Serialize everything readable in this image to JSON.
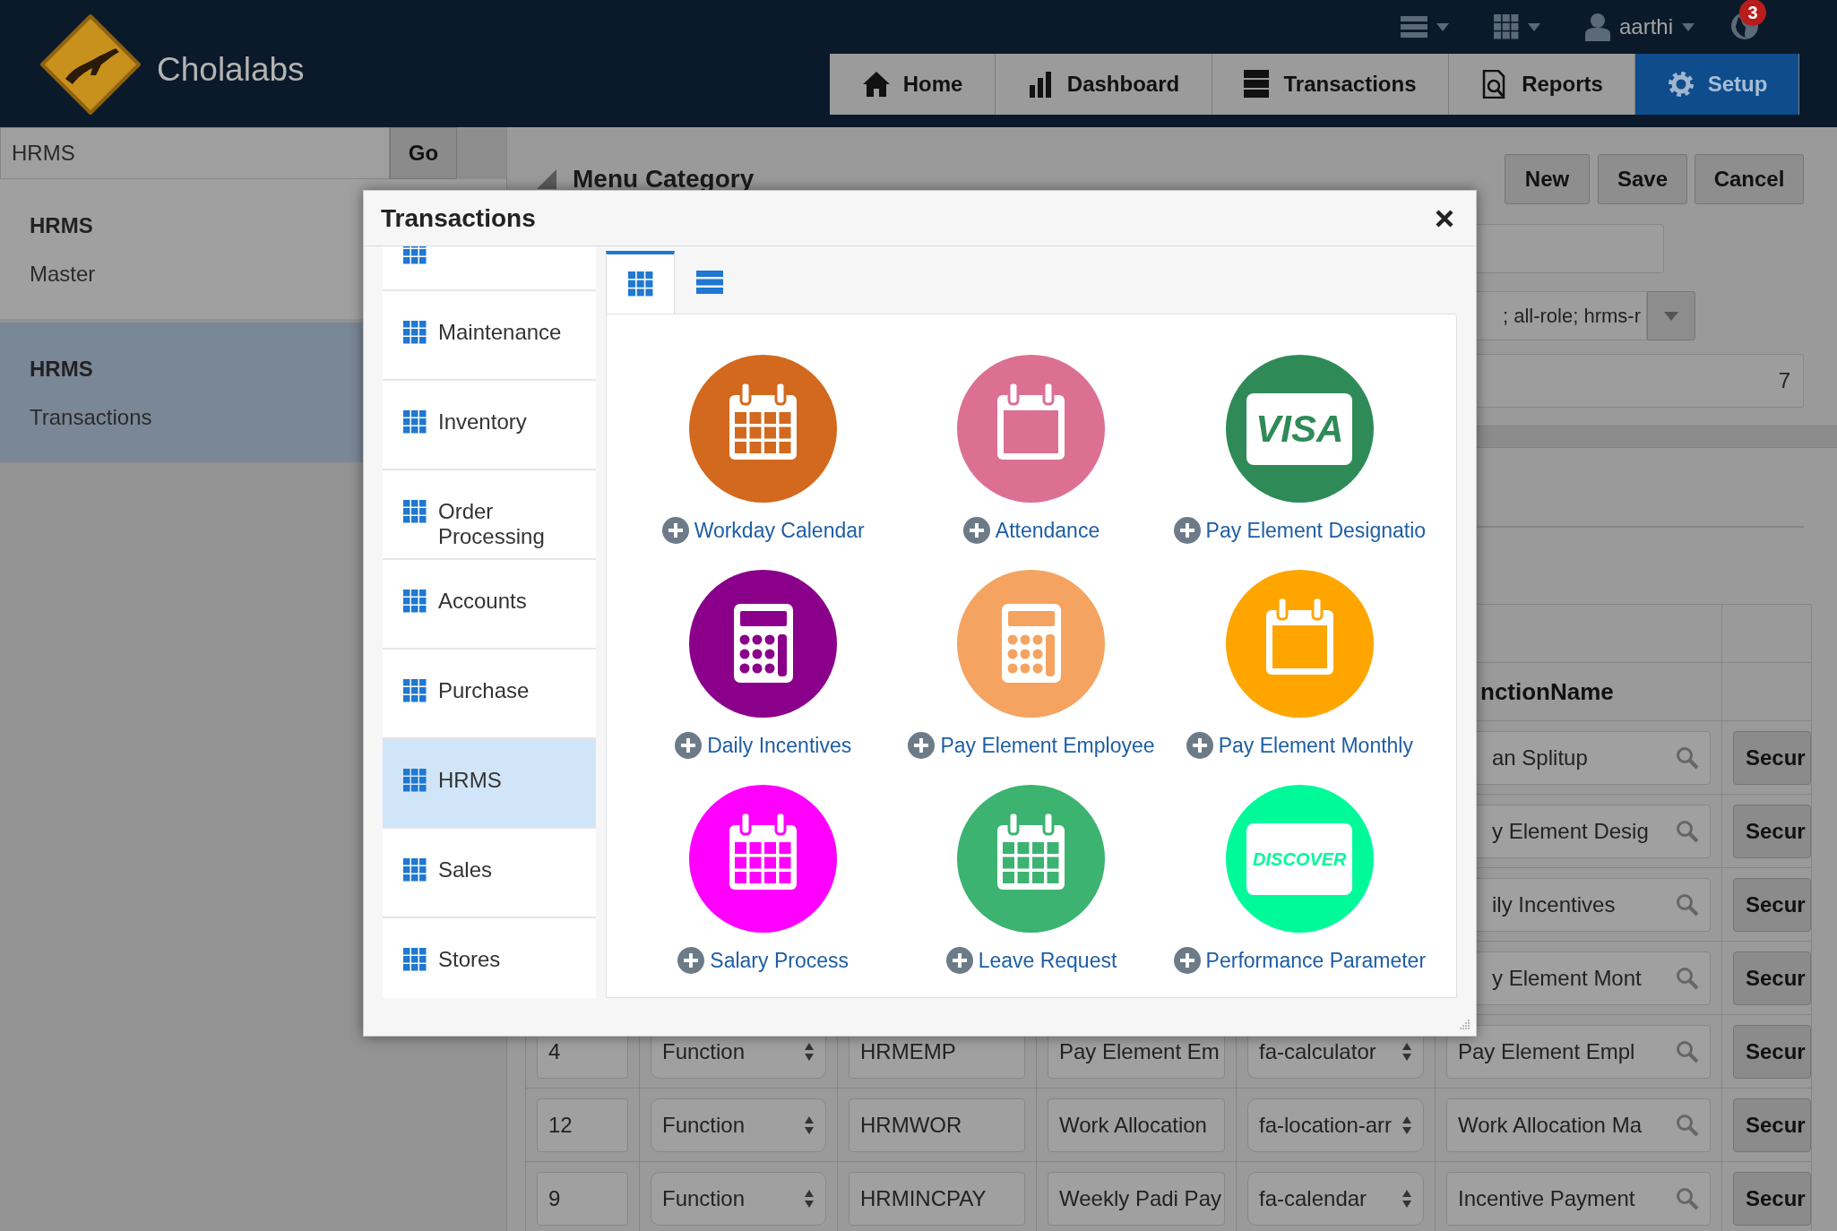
{
  "app": {
    "name": "Cholalabs"
  },
  "top_menu": {
    "user": "aarthi",
    "notification_count": "3"
  },
  "nav_tabs": [
    {
      "label": "Home",
      "selected": false
    },
    {
      "label": "Dashboard",
      "selected": false
    },
    {
      "label": "Transactions",
      "selected": false
    },
    {
      "label": "Reports",
      "selected": false
    },
    {
      "label": "Setup",
      "selected": true
    }
  ],
  "sidebar": {
    "search": {
      "value": "HRMS",
      "button": "Go"
    },
    "groups": [
      {
        "title": "HRMS",
        "item": "Master",
        "selected": false
      },
      {
        "title": "HRMS",
        "item": "Transactions",
        "selected": true
      }
    ]
  },
  "form": {
    "title": "Menu Category",
    "buttons": [
      "New",
      "Save",
      "Cancel"
    ],
    "roles_value": "; all-role; hrms-r",
    "order_value": "7"
  },
  "table": {
    "column_6": "nctionName",
    "rows": [
      {
        "function_name": "an Splitup",
        "action": "Secur"
      },
      {
        "function_name": "y Element Desig",
        "action": "Secur"
      },
      {
        "function_name": "ily Incentives",
        "action": "Secur"
      },
      {
        "function_name": "y Element Mont",
        "action": "Secur"
      },
      {
        "number": "4",
        "type": "Function",
        "code": "HRMEMP",
        "title": "Pay Element Em",
        "icon_name": "fa-calculator",
        "function_name": "Pay Element Empl",
        "action": "Secur"
      },
      {
        "number": "12",
        "type": "Function",
        "code": "HRMWOR",
        "title": "Work Allocation",
        "icon_name": "fa-location-arr",
        "function_name": "Work Allocation Ma",
        "action": "Secur"
      },
      {
        "number": "9",
        "type": "Function",
        "code": "HRMINCPAY",
        "title": "Weekly Padi Pay",
        "icon_name": "fa-calendar",
        "function_name": "Incentive Payment",
        "action": "Secur"
      }
    ]
  },
  "modal": {
    "title": "Transactions",
    "categories": [
      {
        "label": "Maintenance",
        "selected": false
      },
      {
        "label": "Inventory",
        "selected": false
      },
      {
        "label": "Order Processing",
        "selected": false
      },
      {
        "label": "Accounts",
        "selected": false
      },
      {
        "label": "Purchase",
        "selected": false
      },
      {
        "label": "HRMS",
        "selected": true
      },
      {
        "label": "Sales",
        "selected": false
      },
      {
        "label": "Stores",
        "selected": false
      }
    ],
    "view_tabs": [
      {
        "kind": "grid",
        "selected": true
      },
      {
        "kind": "list",
        "selected": false
      }
    ],
    "tiles": [
      {
        "label": "Workday Calendar",
        "kind": "calendar_grid",
        "color": "#d2691e"
      },
      {
        "label": "Attendance",
        "kind": "calendar",
        "color": "#db7093"
      },
      {
        "label": "Pay Element Designatio",
        "kind": "card",
        "logo": "VISA",
        "color": "#2e8b57"
      },
      {
        "label": "Daily Incentives",
        "kind": "calculator",
        "color": "#8b008b"
      },
      {
        "label": "Pay Element Employee",
        "kind": "calculator",
        "color": "#f4a460"
      },
      {
        "label": "Pay Element Monthly",
        "kind": "calendar",
        "color": "#ffa500"
      },
      {
        "label": "Salary Process",
        "kind": "calendar_grid",
        "color": "#ff00ff"
      },
      {
        "label": "Leave Request",
        "kind": "calendar_grid",
        "color": "#3cb371"
      },
      {
        "label": "Performance Parameter",
        "kind": "card",
        "logo": "DISCOVER",
        "color": "#00fa9a"
      }
    ]
  }
}
